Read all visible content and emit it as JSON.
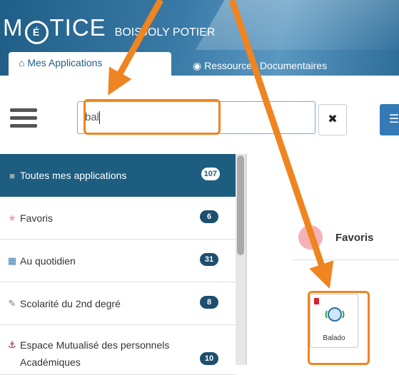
{
  "header": {
    "logo_left": "M",
    "logo_circle": "É",
    "logo_right": "TICE",
    "subtitle": "BOISJOLY POTIER",
    "tabs": [
      {
        "label": "Mes Applications",
        "icon": "home-icon",
        "active": true
      },
      {
        "label": "Ressources Documentaires",
        "icon": "target-icon",
        "active": false
      }
    ]
  },
  "toolbar": {
    "search_value": "bal",
    "clear_label": "✖"
  },
  "sidebar": {
    "items": [
      {
        "label": "Toutes mes applications",
        "badge": "107",
        "icon": "square-icon",
        "active": true
      },
      {
        "label": "Favoris",
        "badge": "6",
        "icon": "star-icon"
      },
      {
        "label": "Au quotidien",
        "badge": "31",
        "icon": "calendar-icon"
      },
      {
        "label": "Scolarité du 2nd degré",
        "badge": "8",
        "icon": "edit-icon"
      },
      {
        "label": "Espace Mutualisé des personnels Académiques",
        "badge": "10",
        "icon": "sitemap-icon"
      }
    ]
  },
  "main": {
    "section_title": "Favoris",
    "app_tiles": [
      {
        "label": "Balado",
        "icon": "podcast-icon"
      }
    ]
  },
  "colors": {
    "accent": "#1d5d80",
    "highlight": "#ef8420",
    "favoris_dot": "#f4b2b8",
    "flag": "#d9212c"
  }
}
